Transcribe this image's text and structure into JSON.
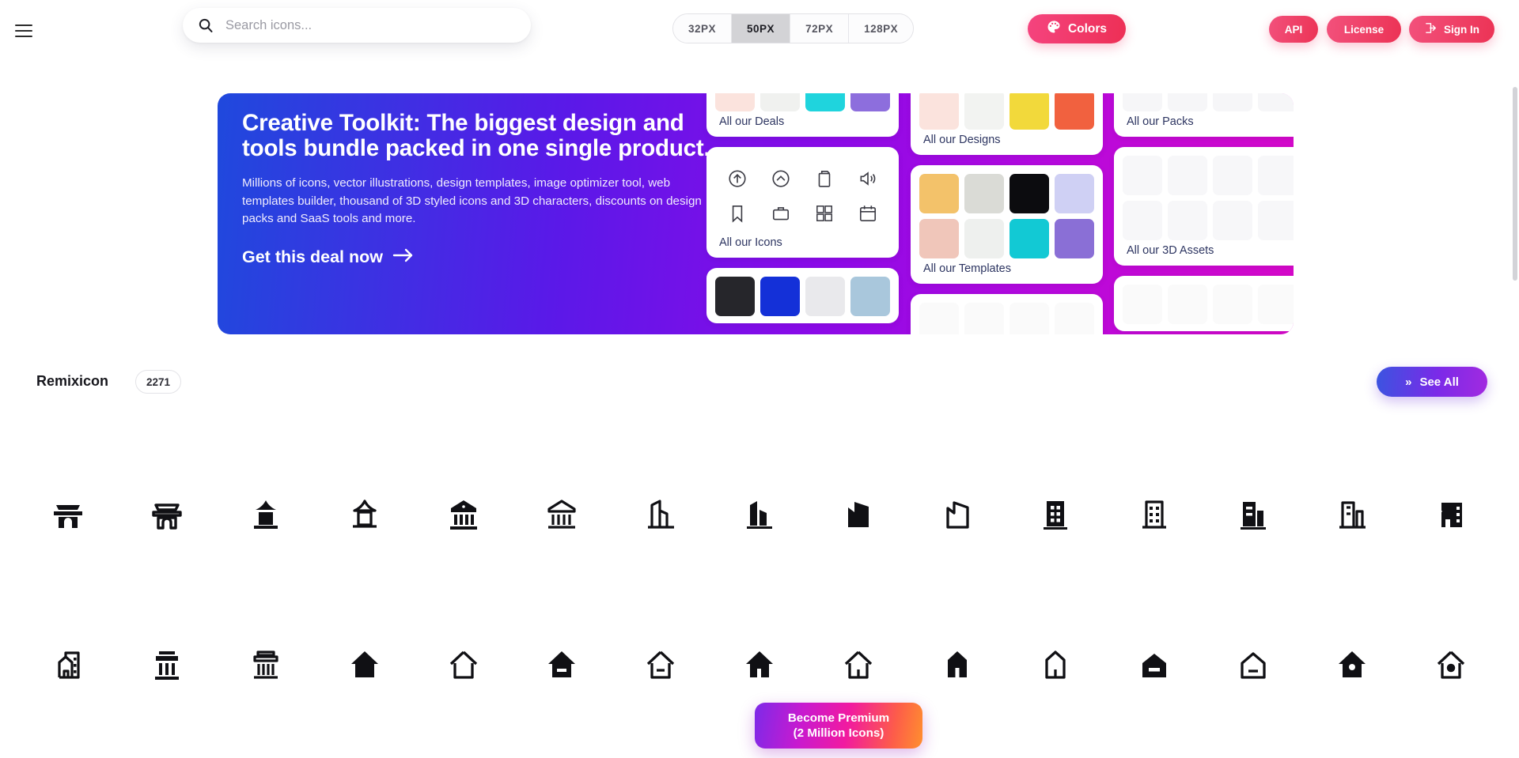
{
  "topbar": {
    "menu_label": "Menu",
    "search": {
      "placeholder": "Search icons...",
      "value": ""
    },
    "sizes": [
      {
        "label": "32PX",
        "active": false
      },
      {
        "label": "50PX",
        "active": true
      },
      {
        "label": "72PX",
        "active": false
      },
      {
        "label": "128PX",
        "active": false
      }
    ],
    "colors_label": "Colors",
    "api_label": "API",
    "license_label": "License",
    "signin_label": "Sign In",
    "accent_pink": "#ed2f55",
    "accent_pink_light": "#f5447f"
  },
  "banner": {
    "title": "Creative Toolkit: The biggest design and tools bundle packed in one single product.",
    "subtitle": "Millions of icons, vector illustrations, design templates, image optimizer tool, web templates builder, thousand of 3D styled icons and 3D characters, discounts on design packs and SaaS tools and more.",
    "cta": "Get this deal now",
    "cta_arrow": "arrow-right-icon",
    "gradient_start": "#1f49dd",
    "gradient_end": "#d609c9",
    "cards": {
      "deals": "All our Deals",
      "icons": "All our Icons",
      "designs": "All our Designs",
      "templates": "All our Templates",
      "packs": "All our Packs",
      "assets_3d": "All our 3D Assets"
    },
    "icon_card_glyphs": [
      "arrow-up-circle-icon",
      "arrow-up-chevron-circle-icon",
      "file-copy-icon",
      "volume-up-icon",
      "bookmark-icon",
      "briefcase-icon",
      "calculator-icon",
      "calendar-icon"
    ]
  },
  "section": {
    "title": "Remixicon",
    "count": "2271",
    "see_all": "See All",
    "see_all_chevron": "»"
  },
  "icon_grid": {
    "rows": [
      [
        "ancient-gate-fill",
        "ancient-gate-line",
        "ancient-pavilion-fill",
        "ancient-pavilion-line",
        "bank-fill",
        "bank-line",
        "building-2-line",
        "building-2-fill",
        "building-4-fill",
        "building-4-line",
        "building-fill",
        "building-line",
        "building-3-fill",
        "building-3-line",
        "home-office-fill"
      ],
      [
        "home-office-line",
        "government-fill",
        "government-line",
        "home-2-fill",
        "home-2-line",
        "home-3-fill",
        "home-3-line",
        "home-4-fill",
        "home-4-line",
        "home-5-fill",
        "home-5-line",
        "home-6-fill",
        "home-6-line",
        "home-7-fill",
        "home-7-line"
      ]
    ]
  },
  "premium": {
    "line1": "Become Premium",
    "line2": "(2 Million Icons)"
  }
}
